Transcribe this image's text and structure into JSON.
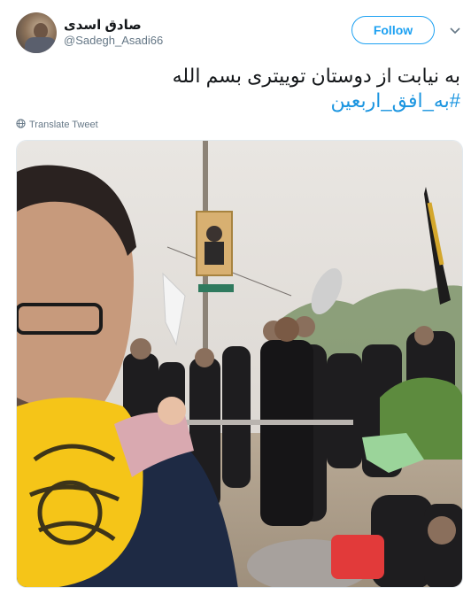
{
  "header": {
    "display_name": "صادق اسدی",
    "handle": "@Sadegh_Asadi66",
    "follow_label": "Follow"
  },
  "tweet": {
    "text": "به نیابت از دوستان توییتری بسم الله",
    "hashtag": "#به_افق_اربعین",
    "translate_label": "Translate Tweet"
  },
  "icons": {
    "caret": "chevron-down-icon",
    "globe": "globe-icon"
  },
  "colors": {
    "accent": "#1da1f2",
    "hashtag": "#1b95e0",
    "muted": "#657786",
    "banner_yellow": "#f5c518"
  }
}
